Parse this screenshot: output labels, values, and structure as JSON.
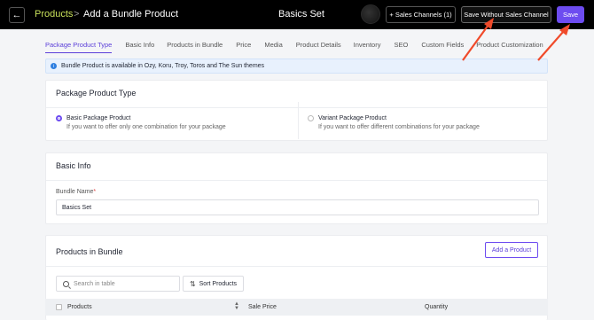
{
  "header": {
    "breadcrumb_link": "Products",
    "breadcrumb_separator": ">",
    "breadcrumb_current": "Add a Bundle Product",
    "center_title": "Basics Set",
    "sales_channels_label": "+ Sales Channels (1)",
    "save_without_label": "Save Without Sales Channel",
    "save_label": "Save"
  },
  "tabs": [
    {
      "label": "Package Product Type",
      "active": true
    },
    {
      "label": "Basic Info"
    },
    {
      "label": "Products in Bundle"
    },
    {
      "label": "Price"
    },
    {
      "label": "Media"
    },
    {
      "label": "Product Details"
    },
    {
      "label": "Inventory"
    },
    {
      "label": "SEO"
    },
    {
      "label": "Custom Fields"
    },
    {
      "label": "Product Customization"
    }
  ],
  "info_bar": {
    "icon": "info-icon",
    "text": "Bundle Product is available in Ozy, Koru, Troy, Toros and The Sun themes"
  },
  "package_type": {
    "title": "Package Product Type",
    "options": [
      {
        "title": "Basic Package Product",
        "desc": "If you want to offer only one combination for your package",
        "selected": true
      },
      {
        "title": "Variant Package Product",
        "desc": "If you want to offer different combinations for your package",
        "selected": false
      }
    ]
  },
  "basic_info": {
    "title": "Basic Info",
    "bundle_name_label": "Bundle Name",
    "required_marker": "*",
    "bundle_name_value": "Basics Set"
  },
  "products_in_bundle": {
    "title": "Products in Bundle",
    "add_product_label": "Add a Product",
    "search_placeholder": "Search in table",
    "sort_label": "Sort Products",
    "columns": [
      "Products",
      "Sale Price",
      "Quantity"
    ]
  },
  "colors": {
    "accent": "#6d4cf0",
    "breadcrumb_link": "#c8e05a",
    "annotation_arrow": "#f04a2a"
  }
}
